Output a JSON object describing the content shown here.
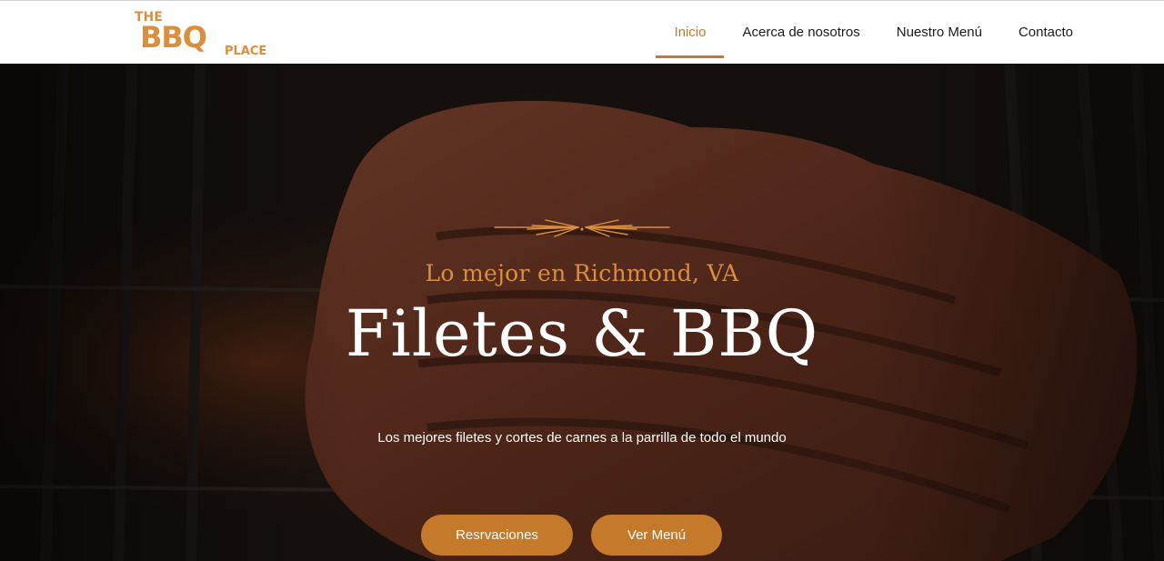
{
  "brand": {
    "logo_text_top": "THE",
    "logo_text_main": "BBQ",
    "logo_text_bottom": "PLACE",
    "accent_color": "#c47a2a",
    "kicker_color": "#d98f3b"
  },
  "nav": {
    "items": [
      {
        "label": "Inicio",
        "active": true
      },
      {
        "label": "Acerca de nosotros",
        "active": false
      },
      {
        "label": "Nuestro Menú",
        "active": false
      },
      {
        "label": "Contacto",
        "active": false
      }
    ]
  },
  "hero": {
    "kicker": "Lo mejor en Richmond, VA",
    "headline": "Filetes & BBQ",
    "subtitle": "Los mejores filetes  y cortes de carnes a la parrilla  de todo el mundo",
    "buttons": {
      "reservations": "Resrvaciones",
      "menu": "Ver Menú"
    },
    "background_icon": "grilled-steak-photo",
    "ornament_icon": "flourish-divider-icon"
  }
}
